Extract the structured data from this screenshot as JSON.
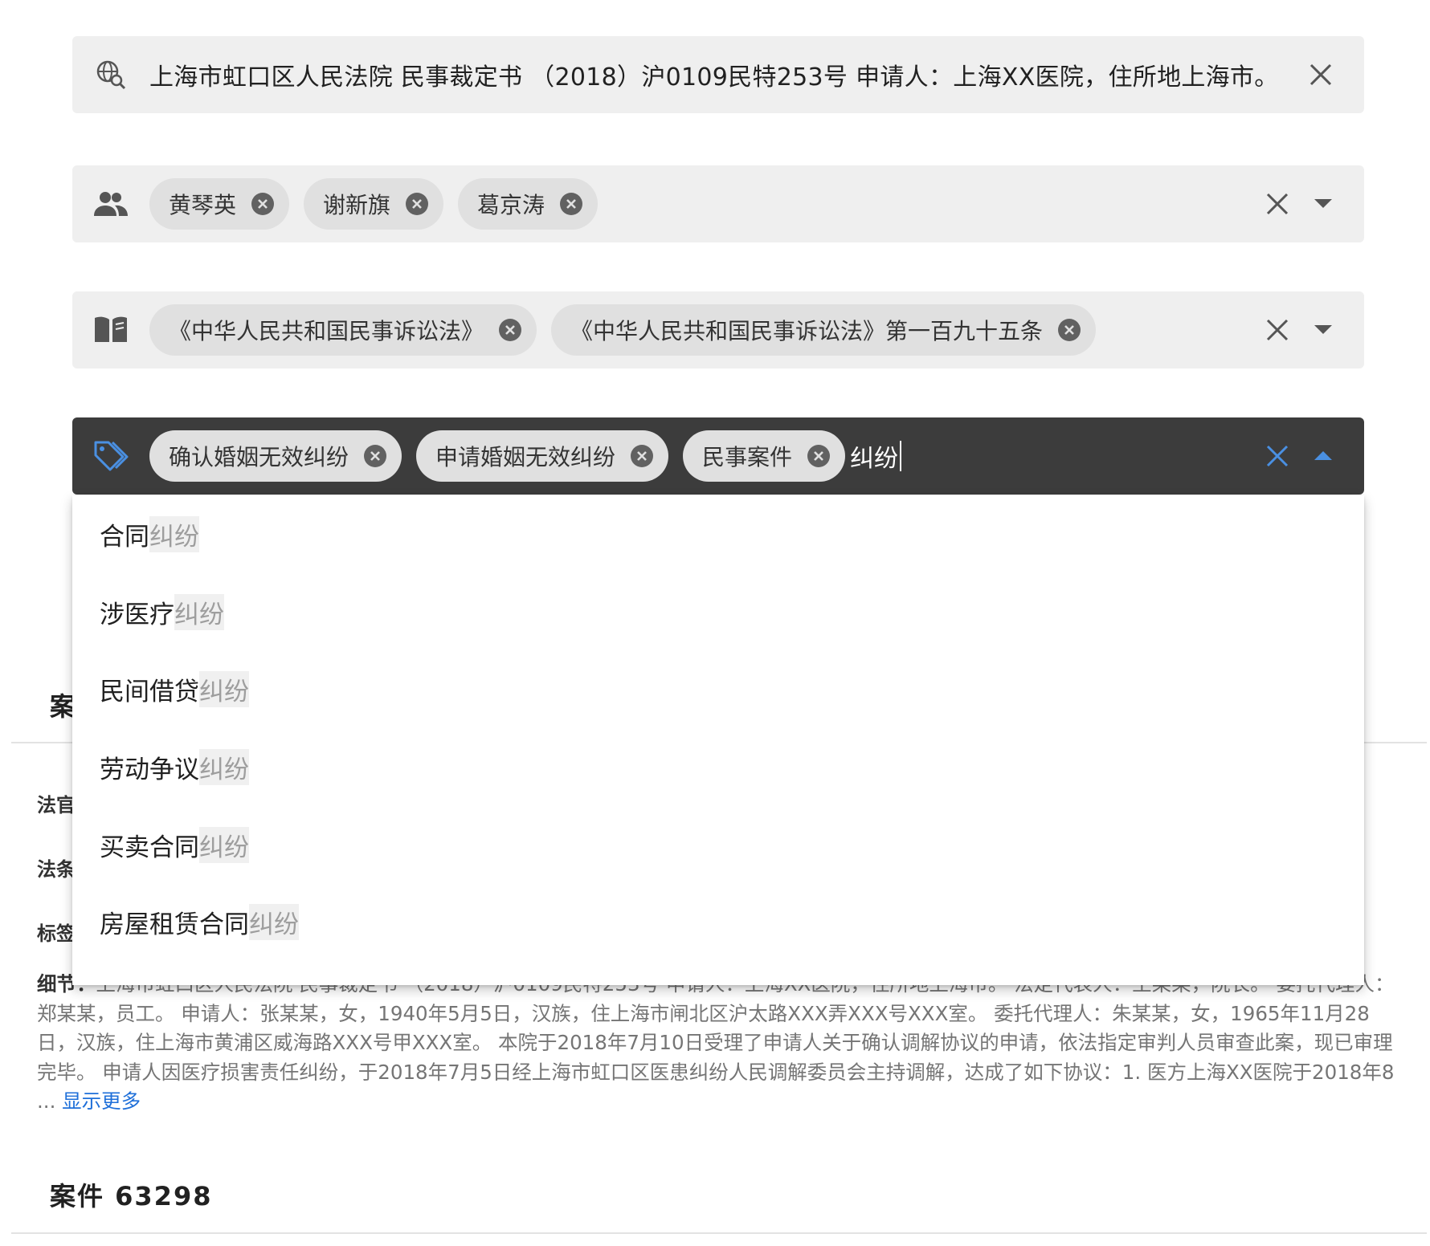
{
  "search": {
    "query": "上海市虹口区人民法院 民事裁定书 （2018）沪0109民特253号 申请人：上海XX医院，住所地上海市。"
  },
  "judges_filter": {
    "chips": [
      "黄琴英",
      "谢新旗",
      "葛京涛"
    ]
  },
  "laws_filter": {
    "chips": [
      "《中华人民共和国民事诉讼法》",
      "《中华人民共和国民事诉讼法》第一百九十五条"
    ]
  },
  "tags_filter": {
    "chips": [
      "确认婚姻无效纠纷",
      "申请婚姻无效纠纷",
      "民事案件"
    ],
    "input_value": "纠纷"
  },
  "suggestions": [
    {
      "prefix": "合同",
      "match": "纠纷"
    },
    {
      "prefix": "涉医疗",
      "match": "纠纷"
    },
    {
      "prefix": "民间借贷",
      "match": "纠纷"
    },
    {
      "prefix": "劳动争议",
      "match": "纠纷"
    },
    {
      "prefix": "买卖合同",
      "match": "纠纷"
    },
    {
      "prefix": "房屋租赁合同",
      "match": "纠纷"
    }
  ],
  "case1": {
    "heading_partial": "案",
    "label_judge": "法官",
    "label_law": "法条",
    "label_tag": "标签",
    "detail_label": "细节：",
    "detail_text": "上海市虹口区人民法院 民事裁定书 （2018）沪0109民特253号 申请人：上海XX医院，住所地上海市。 法定代表人：王某某，院长。 委托代理人：郑某某，员工。 申请人：张某某，女，1940年5月5日，汉族，住上海市闸北区沪太路XXX弄XXX号XXX室。 委托代理人：朱某某，女，1965年11月28日，汉族，住上海市黄浦区威海路XXX号甲XXX室。 本院于2018年7月10日受理了申请人关于确认调解协议的申请，依法指定审判人员审查此案，现已审理完毕。 申请人因医疗损害责任纠纷，于2018年7月5日经上海市虹口区医患纠纷人民调解委员会主持调解，达成了如下协议：1. 医方上海XX医院于2018年8 ...",
    "show_more": "显示更多"
  },
  "case2": {
    "heading": "案件 63298"
  },
  "colors": {
    "bar_bg": "#efefef",
    "active_bar_bg": "#3c3c3c",
    "accent": "#4a90e2",
    "link": "#1e6fd9"
  },
  "icons": {
    "search": "globe-search-icon",
    "judges": "people-icon",
    "laws": "book-icon",
    "tags": "tag-icon"
  }
}
